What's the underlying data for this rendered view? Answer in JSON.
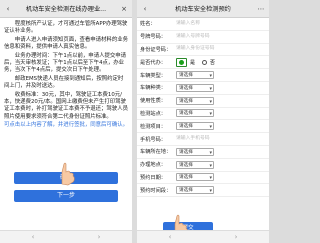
{
  "left": {
    "title": "机动车安全检测在线办理业...",
    "back_icon": "back-chevron-icon",
    "close_icon": "close-icon",
    "paragraphs": [
      "程度核所产认证，才可通过车管所APP办理驾驶证认补业务。",
      "申请人进入申请须知页面，查看申请材料的业务信息和资料，提供申请人真实信息。",
      "业务办理时间：下午1点以前，申请人提交申请后，当天审核发证；下午1点以后至下午4点，办业务，当次下午4点后，提交次日下午处理。",
      "驾驶证补换期间，车管所工作人员在收到的材料，一直至驾驶证及照驾批准后的三个工作日内工作日内，可以直接在车管所，现场办理。",
      "邮政EMS快递人员在接到通知后，按照约定时间上门，并及时送达。",
      "收费标准：30元，其中，驾驶证工本费10元/本，快递费20元/本。国网上缴费但未产生打印驾驶证工本费时，补打驾驶证工本费不予退还；驾驶人员照片使用要求须符合第二代身份证照片标准。"
    ],
    "link_note": "可点击以上内容了解，并进行签批，同意后可确认。",
    "btn_primary": "确定",
    "btn_secondary": "下一步",
    "bottom_left": "‹",
    "bottom_right": "›"
  },
  "right": {
    "title": "机动车安全检测预约",
    "back_icon": "back-chevron-icon",
    "menu_icon": "more-dots-icon",
    "fields": [
      {
        "label": "姓名：",
        "placeholder": "请输入名称"
      },
      {
        "label": "号牌号码：",
        "placeholder": "请输入号牌号码"
      },
      {
        "label": "身份证号码：",
        "placeholder": "请输入身份证号码"
      }
    ],
    "plate_type": {
      "label": "是否代办：",
      "yes": "是",
      "no": "否"
    },
    "selects": [
      {
        "label": "车辆类型：",
        "value": "请选择"
      },
      {
        "label": "车辆种类：",
        "value": "请选择"
      },
      {
        "label": "使用性质：",
        "value": "请选择"
      },
      {
        "label": "检测站点：",
        "value": "请选择"
      },
      {
        "label": "检测项目：",
        "value": "请选择"
      }
    ],
    "phone": {
      "label": "手机号码：",
      "placeholder": "请输入手机号码"
    },
    "selects2": [
      {
        "label": "车辆所在地：",
        "value": "请选择"
      },
      {
        "label": "办理地点：",
        "value": "请选择"
      },
      {
        "label": "预约日期：",
        "value": "请选择"
      },
      {
        "label": "预约时间段：",
        "value": "请选择"
      }
    ],
    "submit": "提交",
    "bottom_left": "‹",
    "bottom_right": "›"
  }
}
